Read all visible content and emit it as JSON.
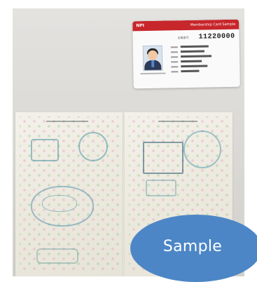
{
  "id_card": {
    "brand": "NPI",
    "header_note": "Membership Card Sample",
    "number_label": "会員番号",
    "number": "11220000"
  },
  "badge": {
    "label": "Sample",
    "color": "#4c86c6"
  },
  "icons": {
    "portrait": "person-portrait-icon"
  }
}
